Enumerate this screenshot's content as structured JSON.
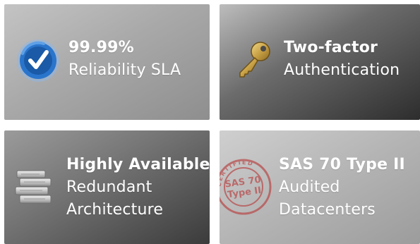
{
  "features": [
    {
      "title": "99.99%",
      "subtitle": "Reliability SLA",
      "icon": "check-circle-icon"
    },
    {
      "title": "Two-factor",
      "subtitle": "Authentication",
      "icon": "key-icon"
    },
    {
      "title": "Highly Available",
      "subtitle_lines": [
        "Redundant",
        "Architecture"
      ],
      "icon": "server-stack-icon"
    },
    {
      "title": "SAS 70 Type II",
      "subtitle_lines": [
        "Audited",
        "Datacenters"
      ],
      "icon": "certified-stamp-icon",
      "stamp": {
        "center_text": [
          "SAS 70",
          "Type II"
        ],
        "ring_text": "CERTIFIED"
      }
    }
  ],
  "colors": {
    "check_blue": "#1c65b8",
    "key_gold": "#c9a246",
    "stamp_red": "#b84a4a"
  }
}
